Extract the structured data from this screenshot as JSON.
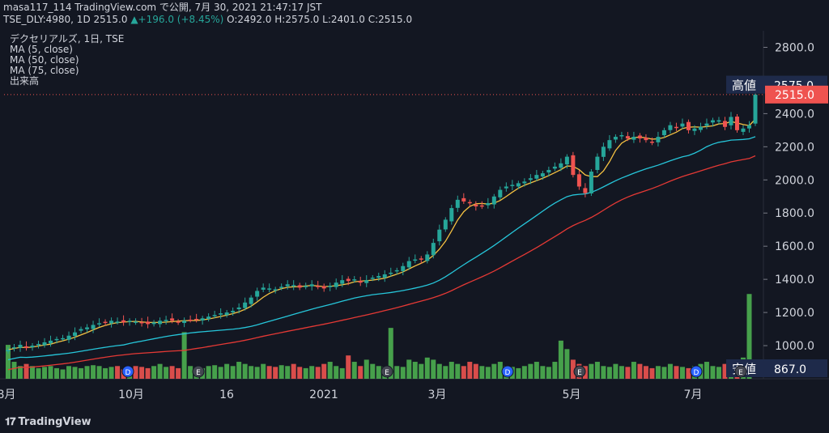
{
  "header": {
    "line1": "masa117_114 TradingView.com で公開, 7月 30, 2021 21:47:17 JST",
    "symbol_info": "TSE_DLY:4980, 1D 2515.0",
    "change": "▲+196.0 (+8.45%)",
    "open": "O:2492.0",
    "high": "H:2575.0",
    "low": "L:2401.0",
    "close": "C:2515.0"
  },
  "legend": {
    "title": "デクセリアルズ, 1日, TSE",
    "ma5": "MA (5, close)",
    "ma50": "MA (50, close)",
    "ma75": "MA (75, close)",
    "volume": "出来高"
  },
  "footer": {
    "brand": "TradingView"
  },
  "colors": {
    "up": "#26a69a",
    "down": "#ef5350",
    "vol_up": "#4caf50",
    "vol_down": "#ef5350",
    "ma5": "#f5c242",
    "ma50": "#26c6da",
    "ma75": "#e53935",
    "bg": "#131722"
  },
  "chart_data": {
    "type": "candlestick",
    "ylim": [
      800,
      2900
    ],
    "y_ticks": [
      "2800.0",
      "2600.0",
      "2400.0",
      "2200.0",
      "2000.0",
      "1800.0",
      "1600.0",
      "1400.0",
      "1200.0",
      "1000.0"
    ],
    "x_ticks": [
      "8月",
      "10月",
      "16",
      "2021",
      "3月",
      "5月",
      "7月"
    ],
    "high_label": "高値",
    "high_value": "2575.0",
    "last_value": "2515.0",
    "low_label": "安値",
    "low_value": "867.0",
    "event_markers": [
      "D",
      "E",
      "E",
      "D",
      "E",
      "D",
      "E"
    ],
    "closes": [
      975,
      990,
      1005,
      985,
      1000,
      1010,
      1020,
      1030,
      1040,
      1045,
      1060,
      1080,
      1100,
      1110,
      1125,
      1135,
      1140,
      1150,
      1145,
      1140,
      1150,
      1145,
      1135,
      1130,
      1140,
      1150,
      1155,
      1150,
      1145,
      1150,
      1155,
      1160,
      1165,
      1175,
      1185,
      1195,
      1200,
      1210,
      1230,
      1260,
      1290,
      1330,
      1350,
      1345,
      1340,
      1355,
      1370,
      1365,
      1350,
      1360,
      1370,
      1355,
      1345,
      1360,
      1380,
      1395,
      1390,
      1400,
      1380,
      1395,
      1410,
      1420,
      1430,
      1440,
      1455,
      1480,
      1510,
      1520,
      1520,
      1550,
      1620,
      1700,
      1760,
      1830,
      1880,
      1870,
      1860,
      1840,
      1840,
      1860,
      1900,
      1940,
      1960,
      1970,
      1980,
      1990,
      2010,
      2030,
      2040,
      2060,
      2080,
      2100,
      2140,
      2030,
      1960,
      1920,
      2050,
      2140,
      2200,
      2240,
      2260,
      2270,
      2250,
      2260,
      2250,
      2240,
      2230,
      2260,
      2300,
      2330,
      2320,
      2340,
      2300,
      2310,
      2320,
      2340,
      2360,
      2360,
      2320,
      2380,
      2300,
      2310,
      2330,
      2515
    ],
    "volume": [
      80,
      40,
      30,
      35,
      30,
      25,
      28,
      30,
      25,
      22,
      30,
      28,
      25,
      30,
      32,
      30,
      25,
      28,
      30,
      22,
      25,
      30,
      28,
      25,
      30,
      35,
      28,
      30,
      25,
      110,
      30,
      28,
      25,
      30,
      32,
      28,
      35,
      30,
      40,
      35,
      30,
      28,
      35,
      30,
      28,
      32,
      30,
      35,
      28,
      25,
      30,
      28,
      35,
      40,
      30,
      25,
      55,
      40,
      30,
      45,
      35,
      30,
      28,
      120,
      30,
      28,
      45,
      40,
      35,
      50,
      45,
      35,
      30,
      40,
      35,
      30,
      40,
      35,
      30,
      28,
      35,
      40,
      30,
      28,
      25,
      30,
      35,
      40,
      30,
      28,
      40,
      90,
      70,
      45,
      35,
      30,
      35,
      40,
      30,
      28,
      35,
      30,
      28,
      40,
      35,
      30,
      25,
      30,
      28,
      35,
      30,
      28,
      25,
      30,
      35,
      40,
      30,
      28,
      35,
      30,
      35,
      50,
      200
    ]
  }
}
